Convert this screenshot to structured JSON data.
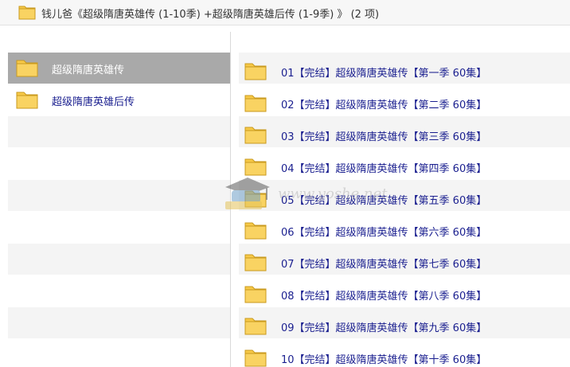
{
  "window": {
    "title": "钱儿爸《超级隋唐英雄传 (1-10季) +超级隋唐英雄后传 (1-9季) 》 (2 项)",
    "icon": "folder-icon"
  },
  "left_pane": {
    "items": [
      {
        "label": "超级隋唐英雄传",
        "icon": "folder-icon",
        "selected": true
      },
      {
        "label": "超级隋唐英雄后传",
        "icon": "folder-icon",
        "selected": false
      }
    ]
  },
  "right_pane": {
    "items": [
      {
        "label": "01【完结】超级隋唐英雄传【第一季 60集】",
        "icon": "folder-icon"
      },
      {
        "label": "02【完结】超级隋唐英雄传【第二季 60集】",
        "icon": "folder-icon"
      },
      {
        "label": "03【完结】超级隋唐英雄传【第三季 60集】",
        "icon": "folder-icon"
      },
      {
        "label": "04【完结】超级隋唐英雄传【第四季 60集】",
        "icon": "folder-icon"
      },
      {
        "label": "05【完结】超级隋唐英雄传【第五季 60集】",
        "icon": "folder-icon"
      },
      {
        "label": "06【完结】超级隋唐英雄传【第六季 60集】",
        "icon": "folder-icon"
      },
      {
        "label": "07【完结】超级隋唐英雄传【第七季 60集】",
        "icon": "folder-icon"
      },
      {
        "label": "08【完结】超级隋唐英雄传【第八季 60集】",
        "icon": "folder-icon"
      },
      {
        "label": "09【完结】超级隋唐英雄传【第九季 60集】",
        "icon": "folder-icon"
      },
      {
        "label": "10【完结】超级隋唐英雄传【第十季 60集】",
        "icon": "folder-icon"
      }
    ]
  },
  "watermark": {
    "text": "www.yoshe.net"
  },
  "colors": {
    "link": "#1a1f8f",
    "selected_bg": "#a9a9a9",
    "stripe": "#f4f4f4",
    "folder_fill": "#f7c948",
    "folder_stroke": "#c99a1e"
  }
}
